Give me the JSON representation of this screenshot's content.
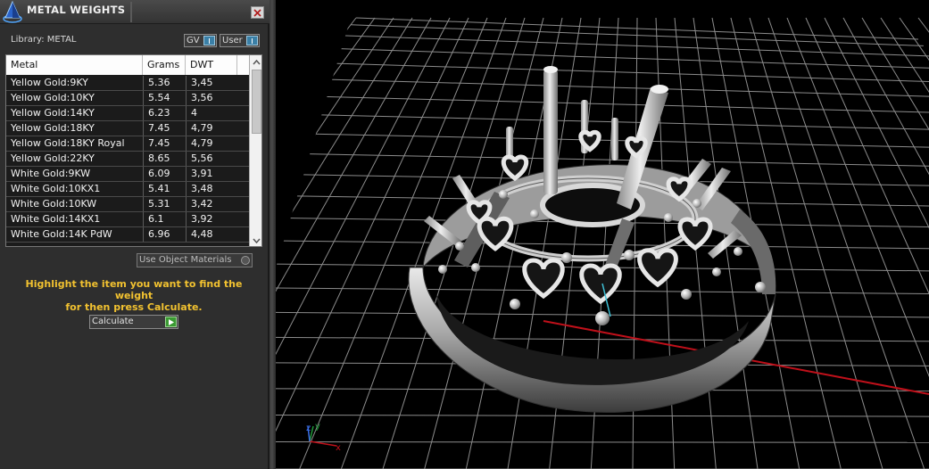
{
  "window": {
    "title": "METAL WEIGHTS",
    "close_icon": "close-icon",
    "app_icon": "pyramid-icon"
  },
  "library": {
    "label": "Library: METAL",
    "gv_label": "GV",
    "user_label": "User"
  },
  "table": {
    "columns": [
      "Metal",
      "Grams",
      "DWT"
    ],
    "rows": [
      {
        "metal": "Yellow Gold:9KY",
        "grams": "5.36",
        "dwt": "3,45"
      },
      {
        "metal": "Yellow Gold:10KY",
        "grams": "5.54",
        "dwt": "3,56"
      },
      {
        "metal": "Yellow Gold:14KY",
        "grams": "6.23",
        "dwt": "4"
      },
      {
        "metal": "Yellow Gold:18KY",
        "grams": "7.45",
        "dwt": "4,79"
      },
      {
        "metal": "Yellow Gold:18KY Royal",
        "grams": "7.45",
        "dwt": "4,79"
      },
      {
        "metal": "Yellow Gold:22KY",
        "grams": "8.65",
        "dwt": "5,56"
      },
      {
        "metal": "White Gold:9KW",
        "grams": "6.09",
        "dwt": "3,91"
      },
      {
        "metal": "White Gold:10KX1",
        "grams": "5.41",
        "dwt": "3,48"
      },
      {
        "metal": "White Gold:10KW",
        "grams": "5.31",
        "dwt": "3,42"
      },
      {
        "metal": "White Gold:14KX1",
        "grams": "6.1",
        "dwt": "3,92"
      },
      {
        "metal": "White Gold:14K PdW",
        "grams": "6.96",
        "dwt": "4,48"
      }
    ]
  },
  "options": {
    "use_object_materials": "Use Object Materials"
  },
  "instructions": {
    "line1": "Highlight the item you want to find the weight",
    "line2": "for then press Calculate."
  },
  "actions": {
    "calculate_label": "Calculate"
  },
  "viewport": {
    "axis_x": "x",
    "axis_y": "y",
    "axis_z": "z",
    "colors": {
      "background": "#000000",
      "grid": "#8c8c8c",
      "x_axis": "#c0101a",
      "y_axis": "#1f9c3a",
      "z_axis": "#3b6fe8"
    }
  }
}
